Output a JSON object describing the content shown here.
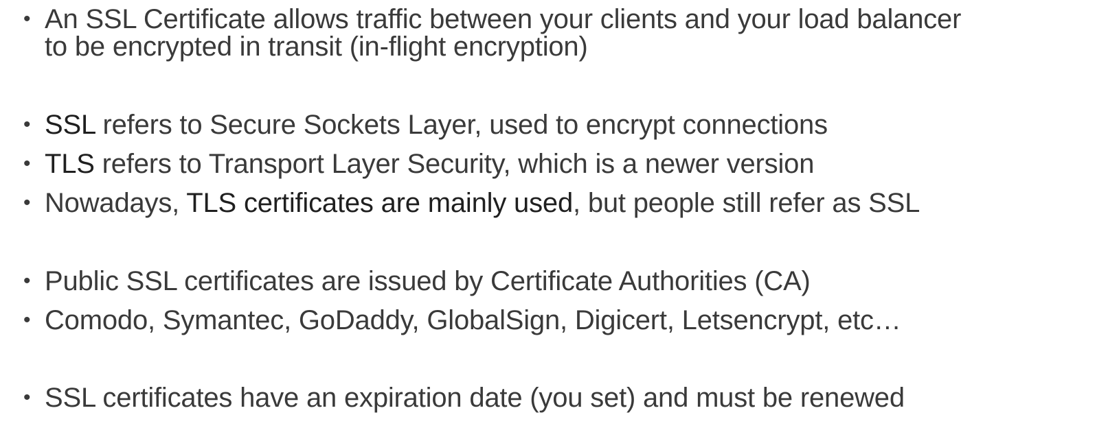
{
  "bullets": {
    "b1_line1": "An SSL Certificate allows traffic between your clients and your load balancer",
    "b1_line2": "to be encrypted in transit (in-flight encryption)",
    "b2_strong": "SSL",
    "b2_rest": " refers to Secure Sockets Layer, used to encrypt connections",
    "b3_strong": "TLS",
    "b3_rest": " refers to Transport Layer Security, which is a newer version",
    "b4_pre": "Nowadays, ",
    "b4_strong": "TLS certificates are mainly used",
    "b4_post": ", but people still refer as SSL",
    "b5": "Public SSL certificates are issued by Certificate Authorities (CA)",
    "b6": "Comodo, Symantec, GoDaddy, GlobalSign, Digicert, Letsencrypt, etc…",
    "b7": "SSL certificates have an expiration date (you set) and must be renewed"
  },
  "bullet_glyph": "•",
  "colors": {
    "text": "#3a3a3a",
    "emphasis": "#1f1f1f",
    "background": "#ffffff"
  }
}
